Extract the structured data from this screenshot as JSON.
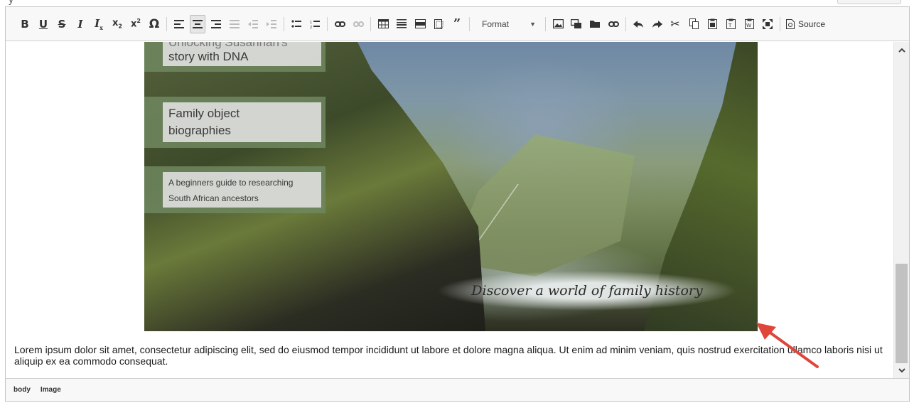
{
  "toolbar": {
    "format_label": "Format",
    "source_label": "Source"
  },
  "content": {
    "nav_items": [
      "Unlocking Susannah's story with DNA",
      "Family object biographies",
      "A beginners guide to researching South African ancestors"
    ],
    "nav1_line1": "Unlocking Susannah's",
    "nav1_line2": "story with DNA",
    "nav2_line1": "Family object",
    "nav2_line2": "biographies",
    "nav3_line1": "A beginners guide to researching",
    "nav3_line2": "South African ancestors",
    "image_tagline": "Discover a world of family history",
    "paragraph": "Lorem ipsum dolor sit amet, consectetur adipiscing elit, sed do eiusmod tempor incididunt ut labore et dolore magna aliqua. Ut enim ad minim veniam, quis nostrud exercitation ullamco laboris nisi ut aliquip ex ea commodo consequat."
  },
  "statusbar": {
    "path": [
      "body",
      "Image"
    ]
  },
  "colors": {
    "annotation_arrow": "#e0453a",
    "toolbar_bg": "#f8f8f8",
    "scroll_thumb": "#c1c1c1"
  },
  "icons": [
    "bold-icon",
    "underline-icon",
    "strikethrough-icon",
    "italic-icon",
    "remove-format-icon",
    "subscript-icon",
    "superscript-icon",
    "special-char-icon",
    "align-left-icon",
    "align-center-icon",
    "align-right-icon",
    "justify-icon",
    "outdent-icon",
    "indent-icon",
    "bulleted-list-icon",
    "numbered-list-icon",
    "link-icon",
    "unlink-icon",
    "table-icon",
    "horizontal-line-icon",
    "div-container-icon",
    "iframe-icon",
    "blockquote-icon",
    "image-icon",
    "image-properties-icon",
    "media-icon",
    "embed-icon",
    "undo-icon",
    "redo-icon",
    "cut-icon",
    "copy-icon",
    "paste-icon",
    "paste-text-icon",
    "paste-word-icon",
    "maximize-icon",
    "source-icon",
    "scroll-up-icon",
    "scroll-down-icon",
    "red-arrow-annotation"
  ]
}
